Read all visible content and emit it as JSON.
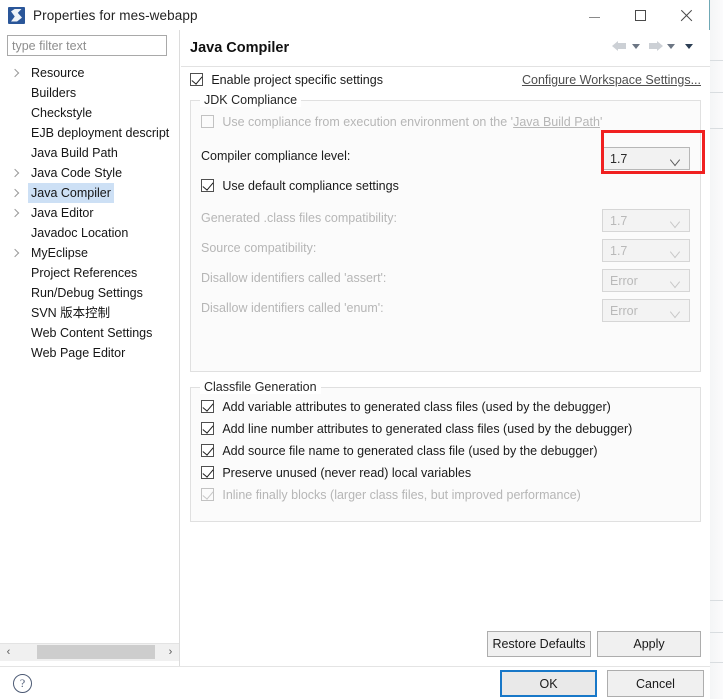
{
  "window": {
    "title": "Properties for mes-webapp",
    "icon": "myeclipse-icon",
    "minimize_label": "Minimize",
    "maximize_label": "Maximize",
    "close_label": "Close"
  },
  "sidebar": {
    "filter": {
      "value": "",
      "placeholder": "type filter text"
    },
    "items": [
      {
        "label": "Resource",
        "expandable": true,
        "selected": false
      },
      {
        "label": "Builders",
        "expandable": false,
        "selected": false
      },
      {
        "label": "Checkstyle",
        "expandable": false,
        "selected": false
      },
      {
        "label": "EJB deployment descript",
        "expandable": false,
        "selected": false
      },
      {
        "label": "Java Build Path",
        "expandable": false,
        "selected": false
      },
      {
        "label": "Java Code Style",
        "expandable": true,
        "selected": false
      },
      {
        "label": "Java Compiler",
        "expandable": true,
        "selected": true
      },
      {
        "label": "Java Editor",
        "expandable": true,
        "selected": false
      },
      {
        "label": "Javadoc Location",
        "expandable": false,
        "selected": false
      },
      {
        "label": "MyEclipse",
        "expandable": true,
        "selected": false
      },
      {
        "label": "Project References",
        "expandable": false,
        "selected": false
      },
      {
        "label": "Run/Debug Settings",
        "expandable": false,
        "selected": false
      },
      {
        "label": "SVN 版本控制",
        "expandable": false,
        "selected": false
      },
      {
        "label": "Web Content Settings",
        "expandable": false,
        "selected": false
      },
      {
        "label": "Web Page Editor",
        "expandable": false,
        "selected": false
      }
    ],
    "scroll_left_label": "‹",
    "scroll_right_label": "›"
  },
  "page": {
    "title": "Java Compiler",
    "enable_specific": {
      "label": "Enable project specific settings",
      "checked": true
    },
    "workspace_link": "Configure Workspace Settings...",
    "jdk_compliance": {
      "title": "JDK Compliance",
      "use_execution_env": {
        "label_part1": "Use compliance from execution environment on the '",
        "label_link": "Java Build Path",
        "label_part2": "'",
        "checked": false,
        "enabled": false
      },
      "compliance_level": {
        "label": "Compiler compliance level:",
        "value": "1.7",
        "enabled": true,
        "highlighted": true
      },
      "use_default": {
        "label": "Use default compliance settings",
        "checked": true
      },
      "class_files_compat": {
        "label": "Generated .class files compatibility:",
        "value": "1.7",
        "enabled": false
      },
      "source_compat": {
        "label": "Source compatibility:",
        "value": "1.7",
        "enabled": false
      },
      "disallow_assert": {
        "label": "Disallow identifiers called 'assert':",
        "value": "Error",
        "enabled": false
      },
      "disallow_enum": {
        "label": "Disallow identifiers called 'enum':",
        "value": "Error",
        "enabled": false
      }
    },
    "classfile_generation": {
      "title": "Classfile Generation",
      "options": [
        {
          "label": "Add variable attributes to generated class files (used by the debugger)",
          "checked": true,
          "enabled": true
        },
        {
          "label": "Add line number attributes to generated class files (used by the debugger)",
          "checked": true,
          "enabled": true
        },
        {
          "label": "Add source file name to generated class file (used by the debugger)",
          "checked": true,
          "enabled": true
        },
        {
          "label": "Preserve unused (never read) local variables",
          "checked": true,
          "enabled": true
        },
        {
          "label": "Inline finally blocks (larger class files, but improved performance)",
          "checked": true,
          "enabled": false
        }
      ]
    },
    "restore_defaults_label": "Restore Defaults",
    "apply_label": "Apply"
  },
  "footer": {
    "help_label": "?",
    "ok_label": "OK",
    "cancel_label": "Cancel"
  },
  "colors": {
    "highlight_red": "#f02020",
    "selection_blue": "#cde0f5",
    "ok_focus_blue": "#1878c8"
  }
}
